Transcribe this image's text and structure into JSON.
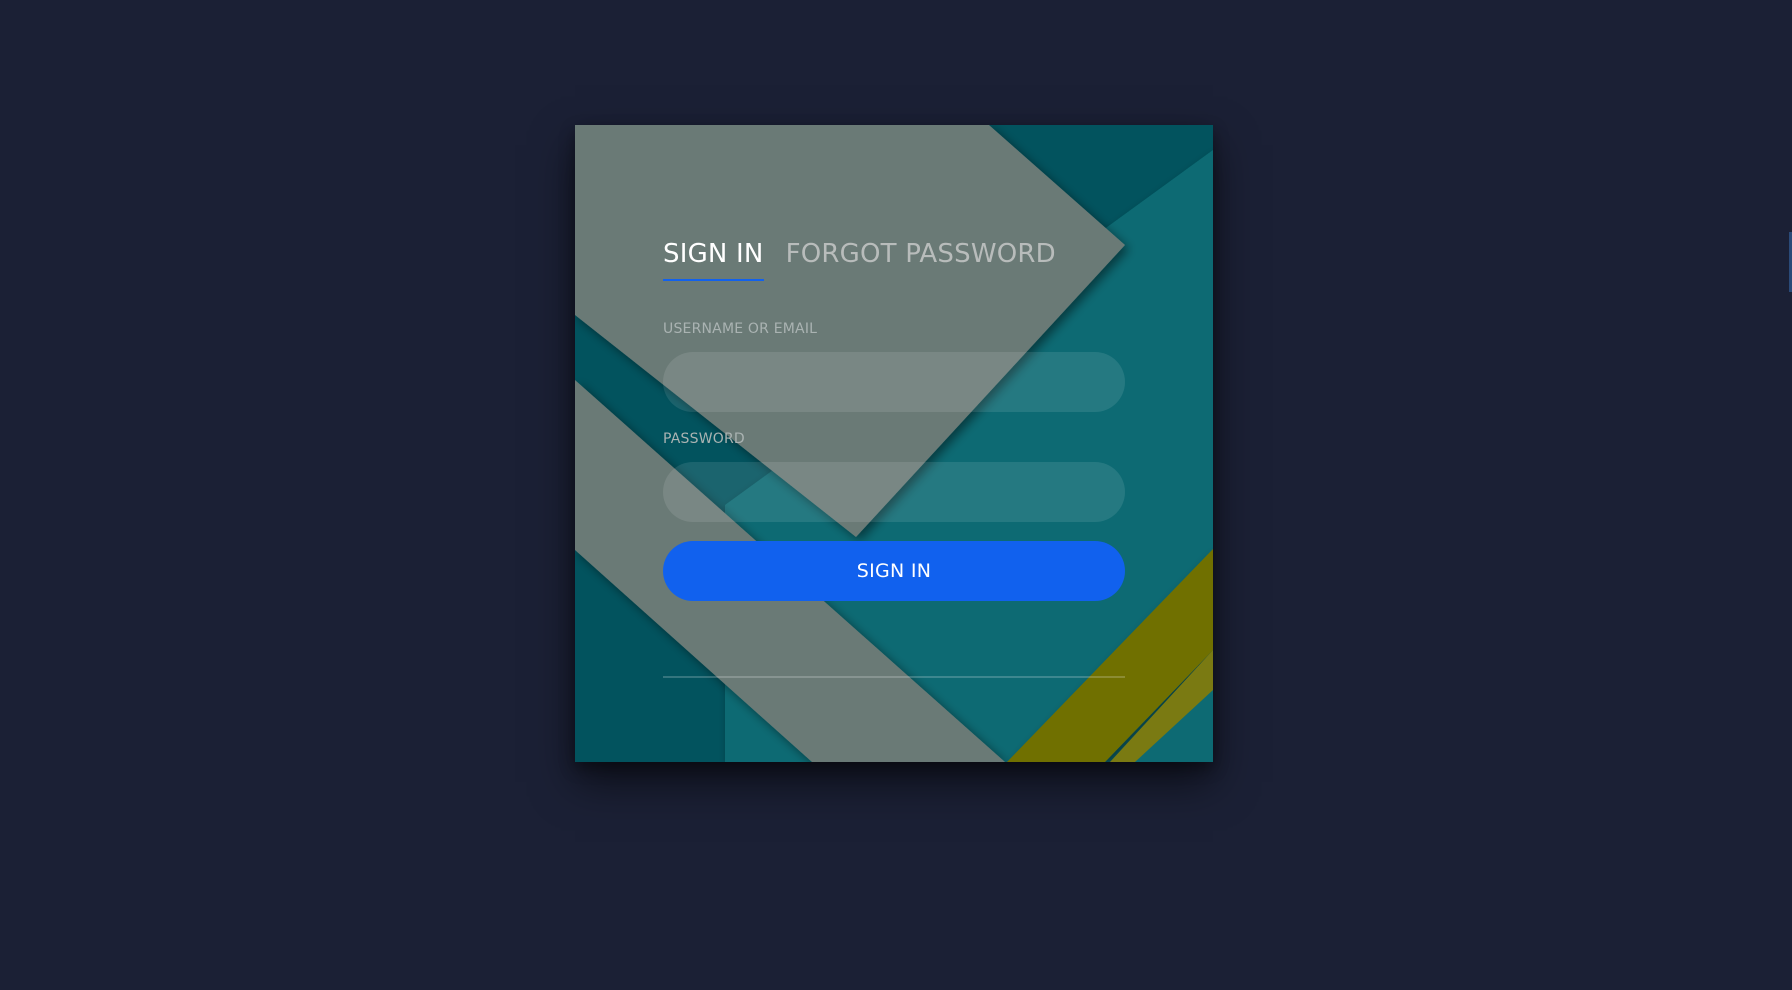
{
  "page": {
    "background_color": "#1b2035"
  },
  "login": {
    "tabs": [
      {
        "label": "SIGN IN",
        "active": true
      },
      {
        "label": "FORGOT PASSWORD",
        "active": false
      }
    ],
    "username": {
      "label": "USERNAME OR EMAIL",
      "value": "",
      "placeholder": ""
    },
    "password": {
      "label": "PASSWORD",
      "value": "",
      "placeholder": ""
    },
    "submit_label": "SIGN IN"
  },
  "colors": {
    "accent": "#1161ee",
    "card_dark_teal": "#02535e",
    "card_teal": "#0a6b73",
    "card_gray": "#6a7a76",
    "card_olive": "#6f6f00"
  },
  "icons": [
    "decorative-background-shapes"
  ]
}
